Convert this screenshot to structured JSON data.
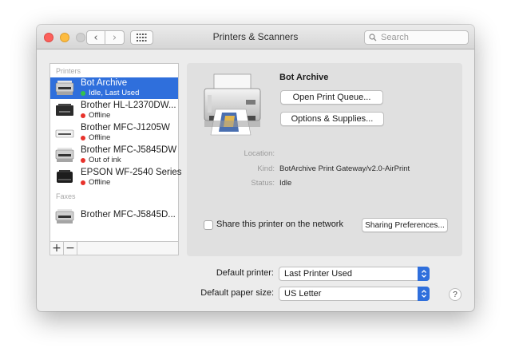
{
  "window": {
    "title": "Printers & Scanners",
    "back_glyph": "‹",
    "forward_glyph": "›",
    "search_placeholder": "Search"
  },
  "sidebar": {
    "printers_header": "Printers",
    "faxes_header": "Faxes",
    "printers": [
      {
        "name": "Bot Archive",
        "status": "Idle, Last Used",
        "status_color": "#35c24c",
        "icon": "multifunction-printer-icon"
      },
      {
        "name": "Brother HL-L2370DW...",
        "status": "Offline",
        "status_color": "#e8322b",
        "icon": "laser-printer-icon"
      },
      {
        "name": "Brother MFC-J1205W",
        "status": "Offline",
        "status_color": "#e8322b",
        "icon": "inkjet-printer-icon"
      },
      {
        "name": "Brother MFC-J5845DW",
        "status": "Out of ink",
        "status_color": "#e8322b",
        "icon": "multifunction-printer-icon"
      },
      {
        "name": "EPSON WF-2540 Series",
        "status": "Offline",
        "status_color": "#e8322b",
        "icon": "epson-printer-icon"
      }
    ],
    "faxes": [
      {
        "name": "Brother MFC-J5845D...",
        "icon": "fax-icon"
      }
    ],
    "add_label": "+",
    "remove_label": "−"
  },
  "detail": {
    "printer_name": "Bot Archive",
    "open_queue_label": "Open Print Queue...",
    "options_label": "Options & Supplies...",
    "location_label": "Location:",
    "location_value": "",
    "kind_label": "Kind:",
    "kind_value": "BotArchive Print Gateway/v2.0-AirPrint",
    "status_label": "Status:",
    "status_value": "Idle",
    "share_label": "Share this printer on the network",
    "share_checked": false,
    "sharing_prefs_label": "Sharing Preferences..."
  },
  "bottom": {
    "default_printer_label": "Default printer:",
    "default_printer_value": "Last Printer Used",
    "paper_size_label": "Default paper size:",
    "paper_size_value": "US Letter",
    "help_label": "?"
  },
  "colors": {
    "accent": "#2f6fdc",
    "close": "#fc605b",
    "minimize": "#fdbc40"
  }
}
